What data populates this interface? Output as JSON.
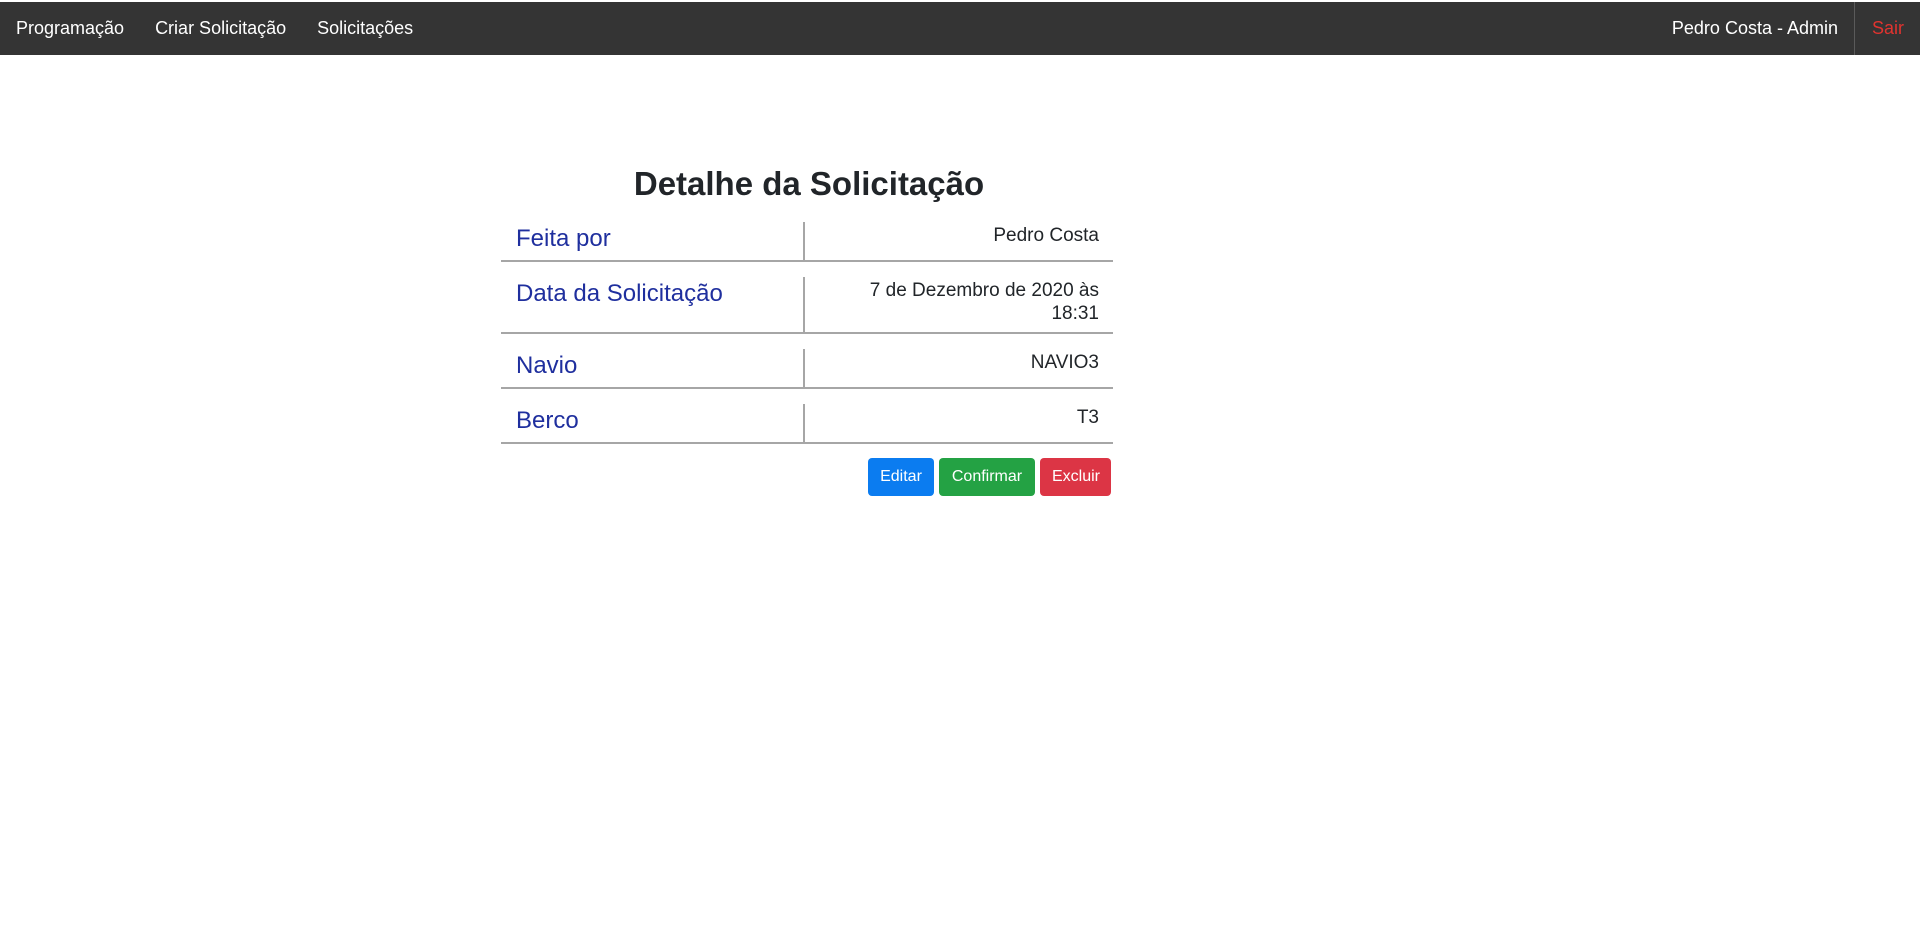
{
  "navbar": {
    "links": [
      "Programação",
      "Criar Solicitação",
      "Solicitações"
    ],
    "user": "Pedro Costa - Admin",
    "logout": "Sair"
  },
  "page": {
    "title": "Detalhe da Solicitação"
  },
  "details": [
    {
      "label": "Feita por",
      "value": "Pedro Costa"
    },
    {
      "label": "Data da Solicitação",
      "value": "7 de Dezembro de 2020 às 18:31"
    },
    {
      "label": "Navio",
      "value": "NAVIO3"
    },
    {
      "label": "Berco",
      "value": "T3"
    }
  ],
  "actions": {
    "edit": "Editar",
    "confirm": "Confirmar",
    "delete": "Excluir"
  },
  "colors": {
    "navbar_bg": "#343434",
    "label_blue": "#1f2f9e",
    "logout_red": "#e0332f",
    "primary": "#0b7cf0",
    "success": "#24a244",
    "danger": "#dc3545"
  }
}
